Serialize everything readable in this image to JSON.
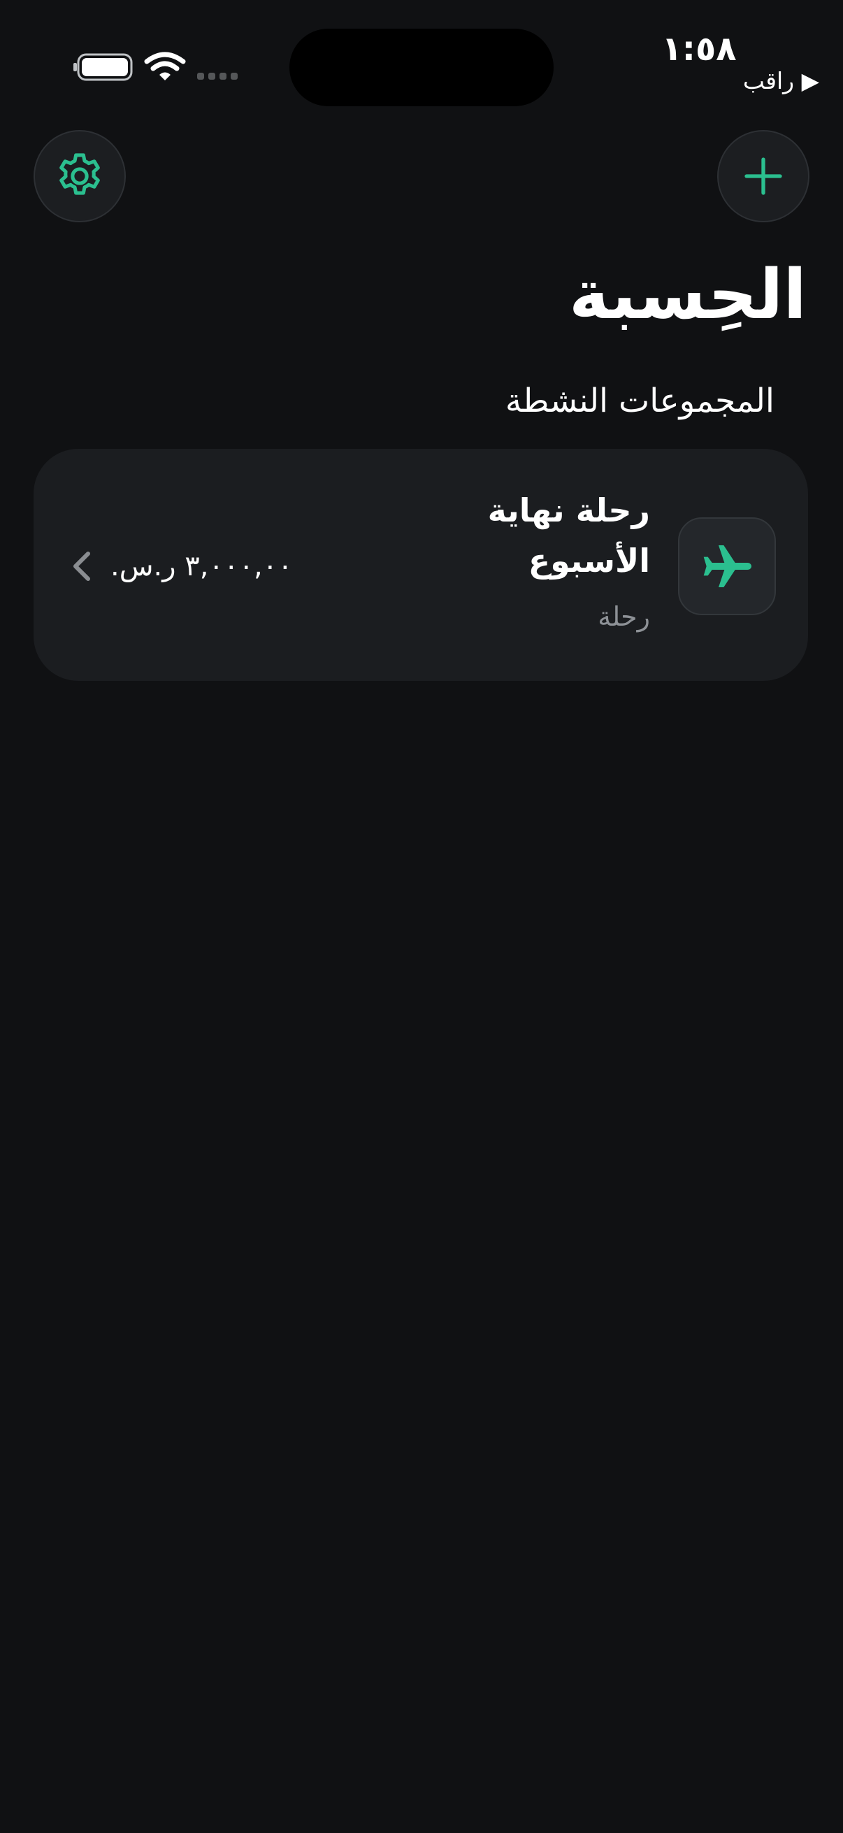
{
  "status_bar": {
    "time": "١:٥٨",
    "location_label": "راقب ▶"
  },
  "header": {
    "title": "الحِسبة",
    "settings_icon": "gear-icon",
    "add_icon": "plus-icon"
  },
  "section": {
    "title": "المجموعات النشطة"
  },
  "groups": [
    {
      "name": "رحلة نهاية الأسبوع",
      "type": "رحلة",
      "amount": "٣,٠٠٠,٠٠ ر.س.",
      "icon": "airplane-icon"
    }
  ],
  "colors": {
    "accent": "#2bbf8f",
    "background": "#101113",
    "card": "#1b1d20"
  }
}
